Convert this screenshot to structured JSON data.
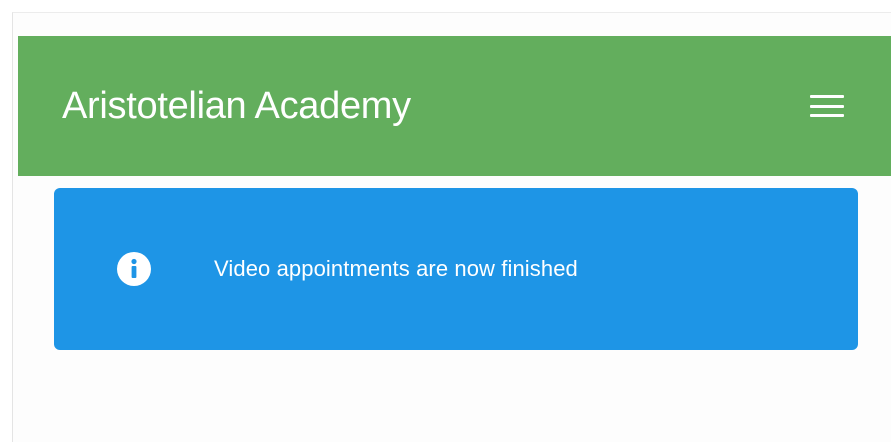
{
  "header": {
    "title": "Aristotelian Academy",
    "menu_icon": "hamburger-menu-icon"
  },
  "alert": {
    "icon": "info-circle-icon",
    "message": "Video appointments are now finished"
  },
  "colors": {
    "header_bg": "#63ae5d",
    "alert_bg": "#1e95e6",
    "text_on_color": "#ffffff"
  }
}
